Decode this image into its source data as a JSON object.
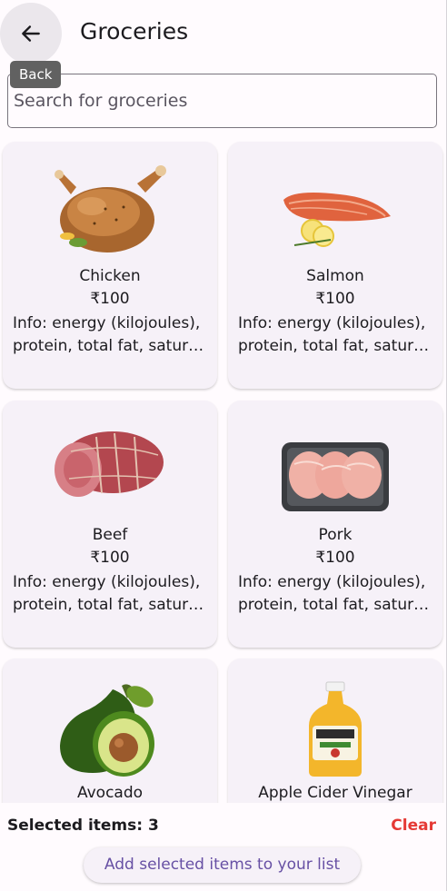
{
  "appbar": {
    "title": "Groceries",
    "back_tooltip": "Back"
  },
  "search": {
    "placeholder": "Search for groceries"
  },
  "products": [
    {
      "name": "Chicken",
      "price": "₹100",
      "info_line1": "Info: energy (kilojoules),",
      "info_line2": "protein, total fat, satura..."
    },
    {
      "name": "Salmon",
      "price": "₹100",
      "info_line1": "Info: energy (kilojoules),",
      "info_line2": "protein, total fat, satura..."
    },
    {
      "name": "Beef",
      "price": "₹100",
      "info_line1": "Info: energy (kilojoules),",
      "info_line2": "protein, total fat, satura..."
    },
    {
      "name": "Pork",
      "price": "₹100",
      "info_line1": "Info: energy (kilojoules),",
      "info_line2": "protein, total fat, satura..."
    },
    {
      "name": "Avocado"
    },
    {
      "name": "Apple Cider Vinegar"
    }
  ],
  "footer": {
    "selected_label": "Selected items: 3",
    "clear_label": "Clear",
    "add_button_label": "Add selected items to your list"
  },
  "colors": {
    "accent": "#6750a4",
    "danger": "#e53935",
    "card_bg": "#f6f1f8"
  }
}
